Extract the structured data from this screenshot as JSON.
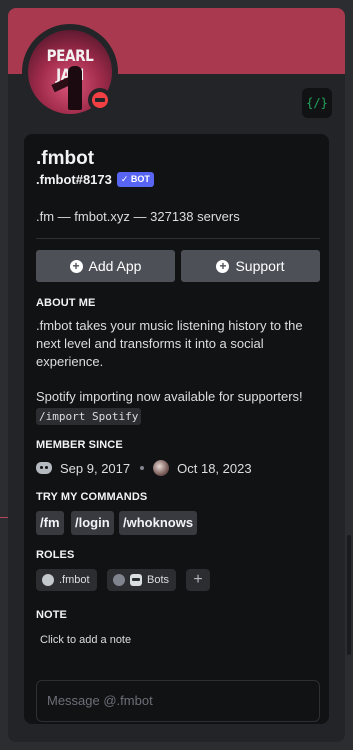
{
  "popout": {
    "banner_color": "#a8394e",
    "avatar": {
      "text": "PEARL JAM",
      "status": "dnd"
    },
    "profile_badge_icon": "code-brackets-icon",
    "profile_badge_text": "{/}"
  },
  "profile": {
    "display_name": ".fmbot",
    "username": ".fmbot#8173",
    "bot_badge": "✓ BOT",
    "description": ".fm — fmbot.xyz — 327138 servers"
  },
  "buttons": {
    "add_app": "Add App",
    "support": "Support"
  },
  "about": {
    "title": "ABOUT ME",
    "paragraph1": ".fmbot takes your music listening history to the next level and transforms it into a social experience.",
    "paragraph2": "Spotify importing now available for supporters!",
    "code": "/import Spotify"
  },
  "member_since": {
    "title": "MEMBER SINCE",
    "discord_date": "Sep 9, 2017",
    "server_date": "Oct 18, 2023"
  },
  "commands": {
    "title": "TRY MY COMMANDS",
    "items": [
      "/fm",
      "/login",
      "/whoknows"
    ]
  },
  "roles": {
    "title": "ROLES",
    "items": [
      ".fmbot",
      "Bots"
    ],
    "add_symbol": "+"
  },
  "note": {
    "title": "NOTE",
    "placeholder": "Click to add a note"
  },
  "message": {
    "placeholder": "Message @.fmbot"
  }
}
